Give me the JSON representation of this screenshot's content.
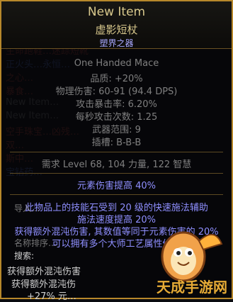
{
  "background_lines": [
    {
      "text": "感恶咒…双重成",
      "cls": ""
    },
    {
      "text": "永恒裹影…血色之",
      "cls": ""
    },
    {
      "text": "攻速生命手套…和",
      "cls": ""
    },
    {
      "text": "生命跑鞋…迷踪短靴",
      "cls": ""
    },
    {
      "text": "正火头…永恒…",
      "cls": "blue"
    },
    {
      "text": "之心…",
      "cls": ""
    },
    {
      "text": "暴食…",
      "cls": ""
    },
    {
      "text": "New Item…",
      "cls": "white"
    },
    {
      "text": "New Item…",
      "cls": "white"
    },
    {
      "text": "空手珠宝…凶残…",
      "cls": ""
    },
    {
      "text": "双…",
      "cls": ""
    },
    {
      "text": "斯中…",
      "cls": ""
    },
    {
      "text": "宝钻药…",
      "cls": "blue"
    }
  ],
  "tooltip": {
    "name": "New Item",
    "base_type": "虚影短杖",
    "tag": "塑界之器",
    "item_class": "One Handed Mace",
    "quality": "品质: +20%",
    "physical_damage": "物理伤害: 60-91 (94.4 DPS)",
    "crit": "攻击暴击率: 6.20%",
    "aps": "每秒攻击次数: 1.25",
    "range": "武器范围: 9",
    "sockets": "插槽: B-B-B",
    "requirements": "需求 Level 68, 104 力量, 122 智慧",
    "implicit": "元素伤害提高 40%",
    "mods": [
      "此物品上的技能石受到 20 级的快速施法辅助",
      "施法速度提高 20%",
      "获得额外混沌伤害, 其数值等同于元素伤害的 20%",
      "可以拥有多个大师工艺属性修正"
    ],
    "bottom_rows": [
      "导入…",
      "名称排序…",
      "搜索:",
      "获得额外混沌伤害",
      "获得额外混沌伤",
      "+27% 元…"
    ]
  },
  "watermark": {
    "text": "天成手游网"
  }
}
